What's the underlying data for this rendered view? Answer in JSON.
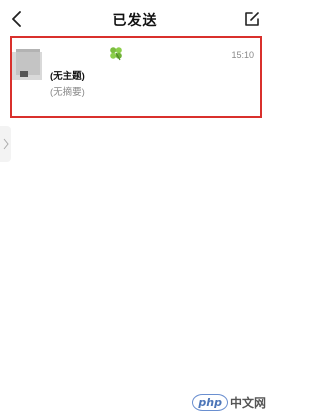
{
  "header": {
    "title": "已发送",
    "back_icon": "chevron-left-icon",
    "compose_icon": "edit-icon"
  },
  "mail_list": [
    {
      "sender_emoji": "clover-icon",
      "time": "15:10",
      "subject": "(无主题)",
      "summary": "(无摘要)"
    }
  ],
  "colors": {
    "highlight": "#d9302c",
    "secondary_text": "#888888"
  },
  "watermark": {
    "badge": "php",
    "text": "中文网"
  }
}
